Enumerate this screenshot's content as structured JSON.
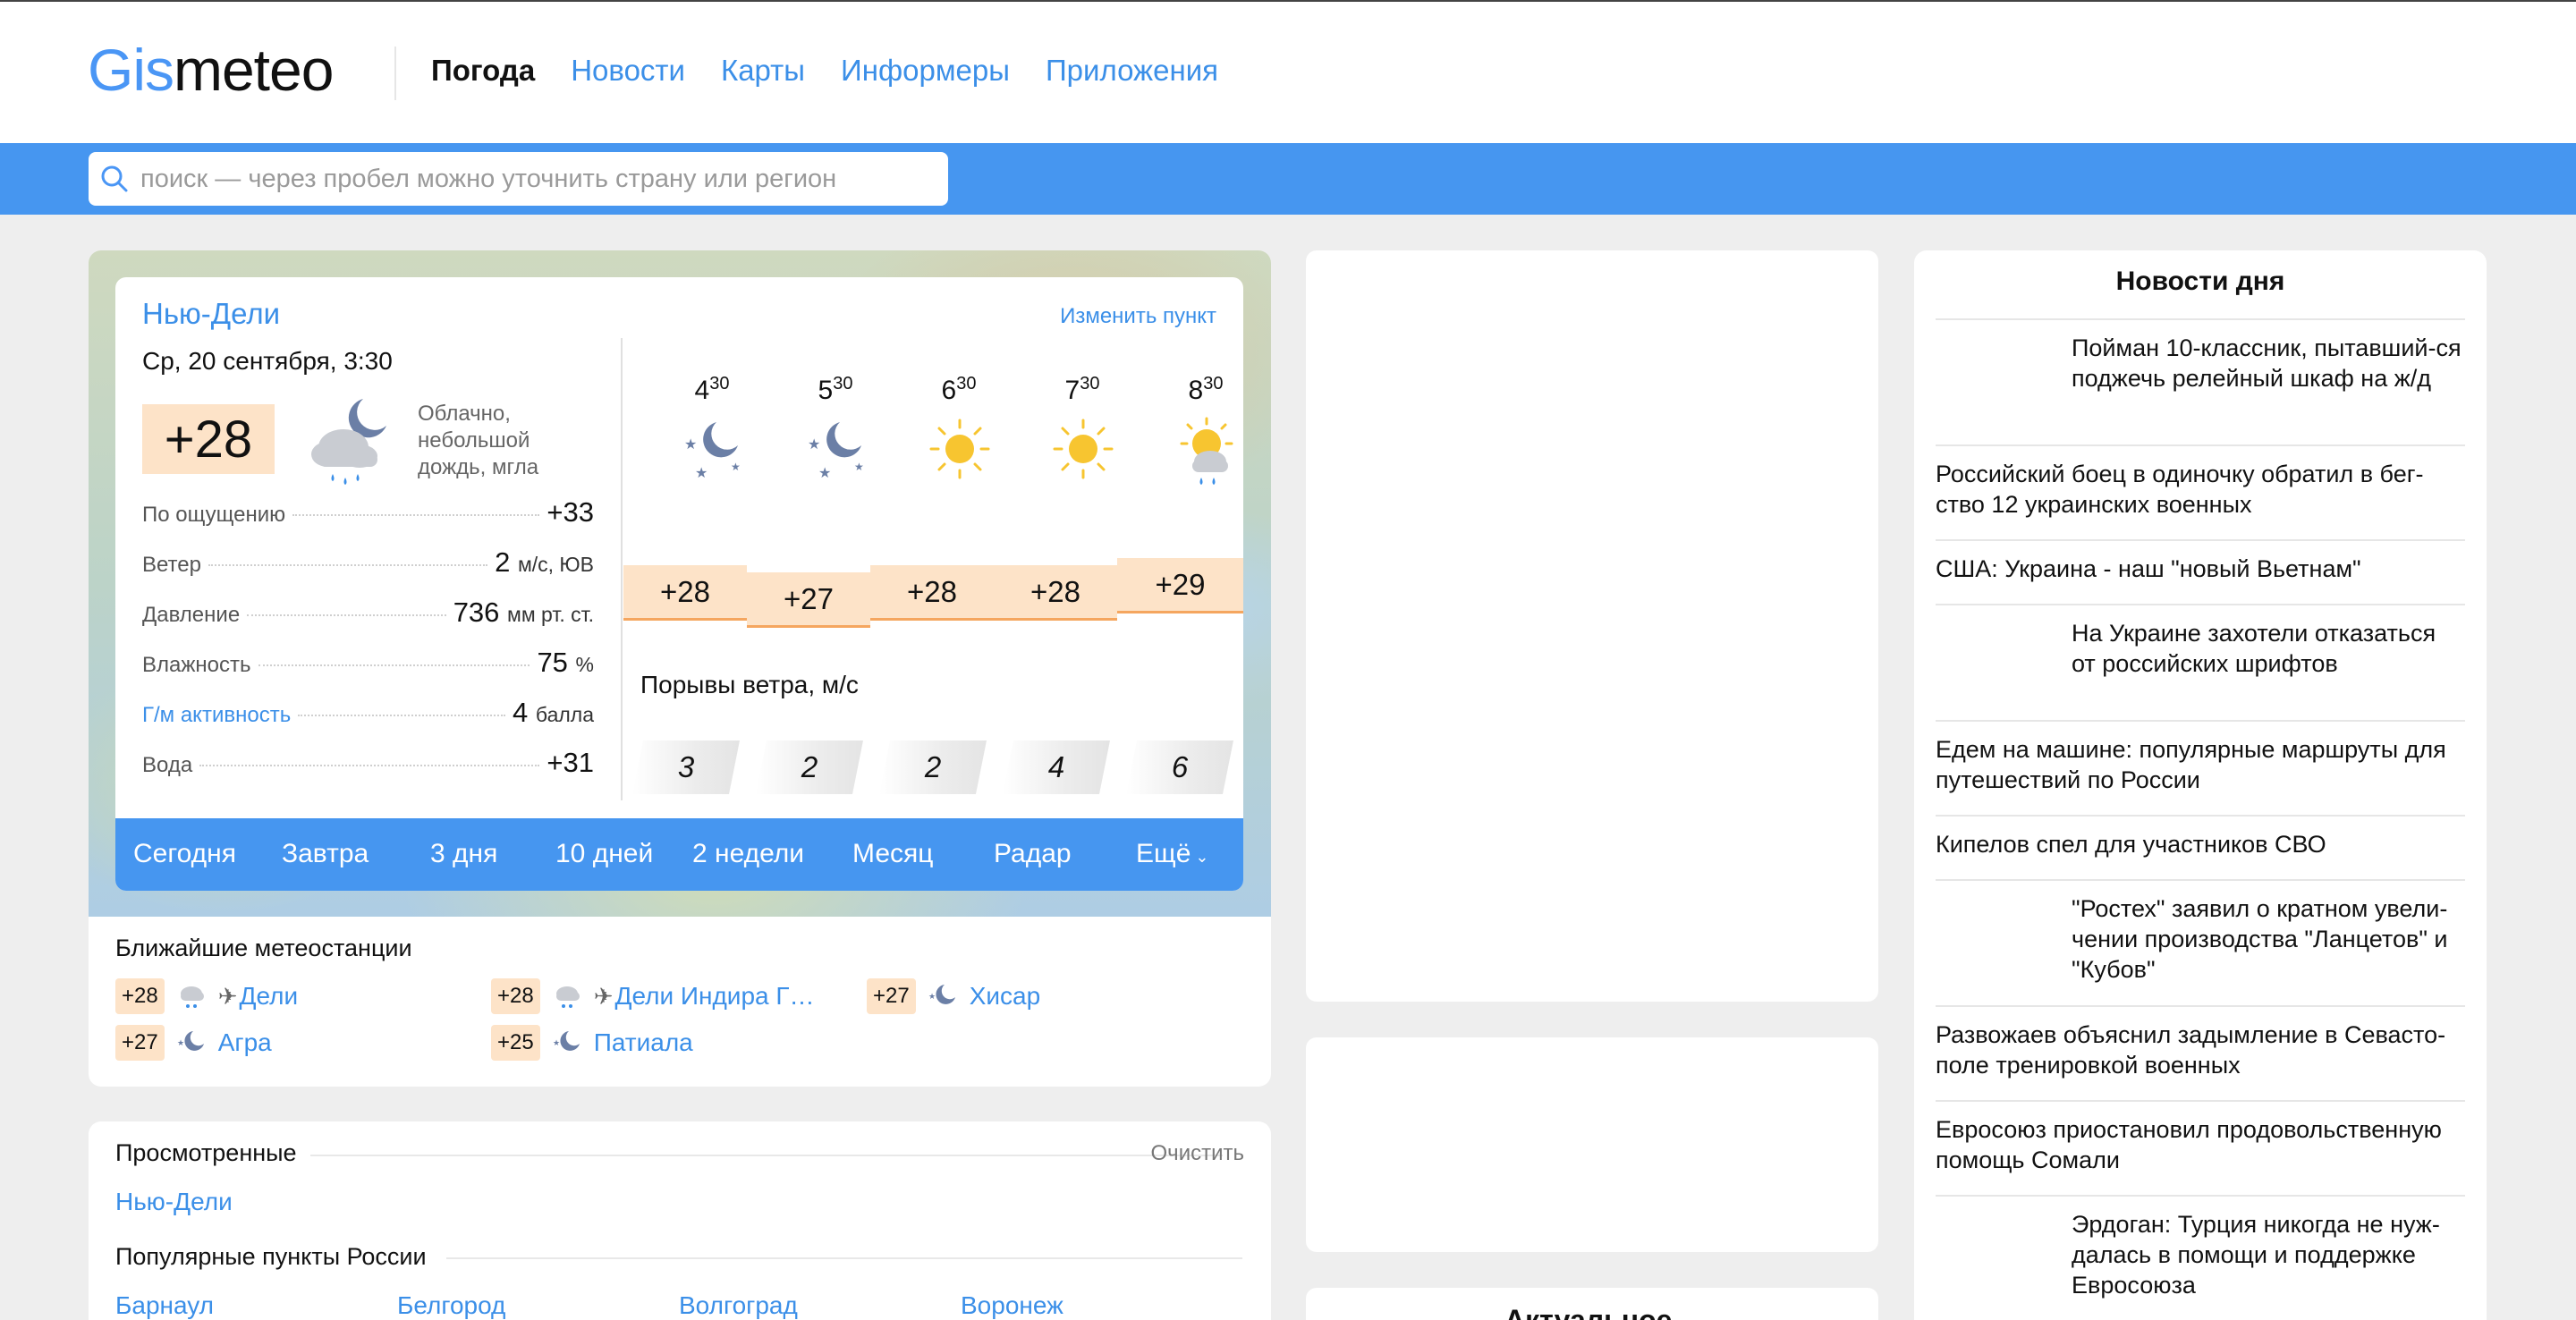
{
  "header": {
    "logo_gis": "Gis",
    "logo_meteo": "meteo",
    "nav": [
      "Погода",
      "Новости",
      "Карты",
      "Информеры",
      "Приложения"
    ]
  },
  "search": {
    "placeholder": "поиск — через пробел можно уточнить страну или регион"
  },
  "weather": {
    "city": "Нью-Дели",
    "change_location": "Изменить пункт",
    "date": "Ср, 20 сентября, 3:30",
    "temp_now": "+28",
    "condition": "Облачно, небольшой дождь, мгла",
    "params": [
      {
        "label": "По ощущению",
        "value": "+33",
        "unit": ""
      },
      {
        "label": "Ветер",
        "value": "2",
        "unit": "м/с, ЮВ"
      },
      {
        "label": "Давление",
        "value": "736",
        "unit": "мм рт. ст."
      },
      {
        "label": "Влажность",
        "value": "75",
        "unit": "%"
      },
      {
        "label": "Г/м активность",
        "value": "4",
        "unit": "балла"
      },
      {
        "label": "Вода",
        "value": "+31",
        "unit": ""
      }
    ],
    "hours": [
      {
        "h": "4",
        "m": "30",
        "icon": "moon-stars-icon",
        "temp": "+28",
        "gust": "3"
      },
      {
        "h": "5",
        "m": "30",
        "icon": "moon-stars-icon",
        "temp": "+27",
        "gust": "2"
      },
      {
        "h": "6",
        "m": "30",
        "icon": "sun-icon",
        "temp": "+28",
        "gust": "2"
      },
      {
        "h": "7",
        "m": "30",
        "icon": "sun-icon",
        "temp": "+28",
        "gust": "4"
      },
      {
        "h": "8",
        "m": "30",
        "icon": "sun-cloud-rain-icon",
        "temp": "+29",
        "gust": "6"
      }
    ],
    "gust_title": "Порывы ветра, м/с",
    "tabs": [
      "Сегодня",
      "Завтра",
      "3 дня",
      "10 дней",
      "2 недели",
      "Месяц",
      "Радар",
      "Ещё"
    ]
  },
  "stations": {
    "title": "Ближайшие метеостанции",
    "items": [
      {
        "temp": "+28",
        "name": "Дели",
        "airport": true
      },
      {
        "temp": "+28",
        "name": "Дели Индира Г…",
        "airport": true
      },
      {
        "temp": "+27",
        "name": "Хисар",
        "airport": false
      },
      {
        "temp": "+27",
        "name": "Агра",
        "airport": false
      },
      {
        "temp": "+25",
        "name": "Патиала",
        "airport": false
      }
    ]
  },
  "viewed": {
    "title": "Просмотренные",
    "clear": "Очистить",
    "items": [
      "Нью-Дели"
    ],
    "popular_title": "Популярные пункты России",
    "popular": [
      "Барнаул",
      "Белгород",
      "Волгоград",
      "Воронеж"
    ]
  },
  "ad": {
    "actual": "Актуальное"
  },
  "news": {
    "title": "Новости дня",
    "items": [
      {
        "text": "Пойман 10-классник, пытавший-ся поджечь релейный шкаф на ж/д",
        "thumb": true
      },
      {
        "text": "Российский боец в одиночку обратил в бег-ство 12 украинских военных",
        "thumb": false
      },
      {
        "text": "США: Украина - наш \"новый Вьетнам\"",
        "thumb": false
      },
      {
        "text": "На Украине захотели отказаться от российских шрифтов",
        "thumb": true
      },
      {
        "text": "Едем на машине: популярные маршруты для путешествий по России",
        "thumb": false
      },
      {
        "text": "Кипелов спел для участников СВО",
        "thumb": false
      },
      {
        "text": "\"Ростех\" заявил о кратном увели-чении производства \"Ланцетов\" и \"Кубов\"",
        "thumb": true
      },
      {
        "text": "Развожаев объяснил задымление в Севасто-поле тренировкой военных",
        "thumb": false
      },
      {
        "text": "Евросоюз приостановил продовольственную помощь Сомали",
        "thumb": false
      },
      {
        "text": "Эрдоган: Турция никогда не нуж-далась в помощи и поддержке Евросоюза",
        "thumb": true
      }
    ]
  }
}
